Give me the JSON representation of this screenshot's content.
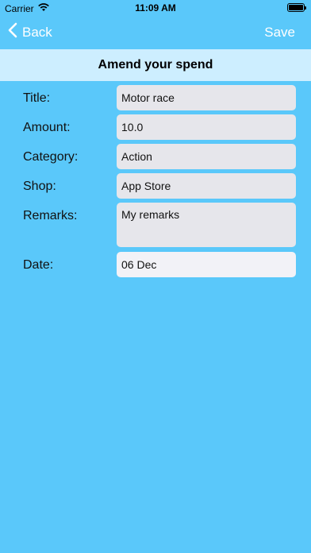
{
  "status": {
    "carrier": "Carrier",
    "time": "11:09 AM"
  },
  "nav": {
    "back_label": "Back",
    "save_label": "Save"
  },
  "page": {
    "title": "Amend your spend"
  },
  "form": {
    "title_label": "Title:",
    "title_value": "Motor race",
    "amount_label": "Amount:",
    "amount_value": "10.0",
    "category_label": "Category:",
    "category_value": "Action",
    "shop_label": "Shop:",
    "shop_value": "App Store",
    "remarks_label": "Remarks:",
    "remarks_value": "My remarks",
    "date_label": "Date:",
    "date_value": "06 Dec"
  },
  "colors": {
    "background": "#5ac8fa",
    "title_band": "#cdeeff",
    "field": "#e6e6eb",
    "nav_text": "#ffffff"
  }
}
